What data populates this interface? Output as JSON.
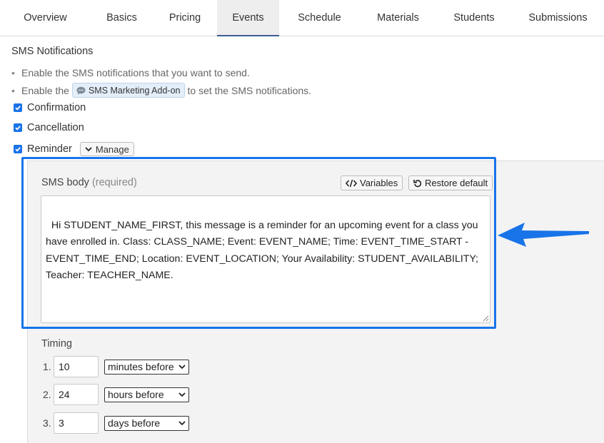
{
  "tabs": [
    {
      "label": "Overview"
    },
    {
      "label": "Basics"
    },
    {
      "label": "Pricing"
    },
    {
      "label": "Events"
    },
    {
      "label": "Schedule"
    },
    {
      "label": "Materials"
    },
    {
      "label": "Students"
    },
    {
      "label": "Submissions"
    }
  ],
  "active_tab": "Events",
  "section_title": "SMS Notifications",
  "bullets": {
    "line1": "Enable the SMS notifications that you want to send.",
    "line2_prefix": "Enable the",
    "addon_label": "SMS Marketing Add-on",
    "line2_suffix": "to set the SMS notifications."
  },
  "checks": {
    "confirmation": "Confirmation",
    "cancellation": "Cancellation",
    "reminder": "Reminder",
    "manage_label": "Manage"
  },
  "sms_body": {
    "label": "SMS body",
    "required": "(required)",
    "variables_label": "Variables",
    "restore_label": "Restore default",
    "text": "Hi STUDENT_NAME_FIRST, this message is a reminder for an upcoming event for a class you have enrolled in. Class: CLASS_NAME; Event: EVENT_NAME; Time: EVENT_TIME_START - EVENT_TIME_END; Location: EVENT_LOCATION; Your Availability: STUDENT_AVAILABILITY; Teacher: TEACHER_NAME."
  },
  "timing": {
    "label": "Timing",
    "rows": [
      {
        "num": "1.",
        "value": "10",
        "unit": "minutes before"
      },
      {
        "num": "2.",
        "value": "24",
        "unit": "hours before"
      },
      {
        "num": "3.",
        "value": "3",
        "unit": "days before"
      }
    ]
  },
  "colors": {
    "accent": "#1874e8",
    "checkbox": "#1a73e8",
    "active_tab_border": "#3b5f91"
  }
}
